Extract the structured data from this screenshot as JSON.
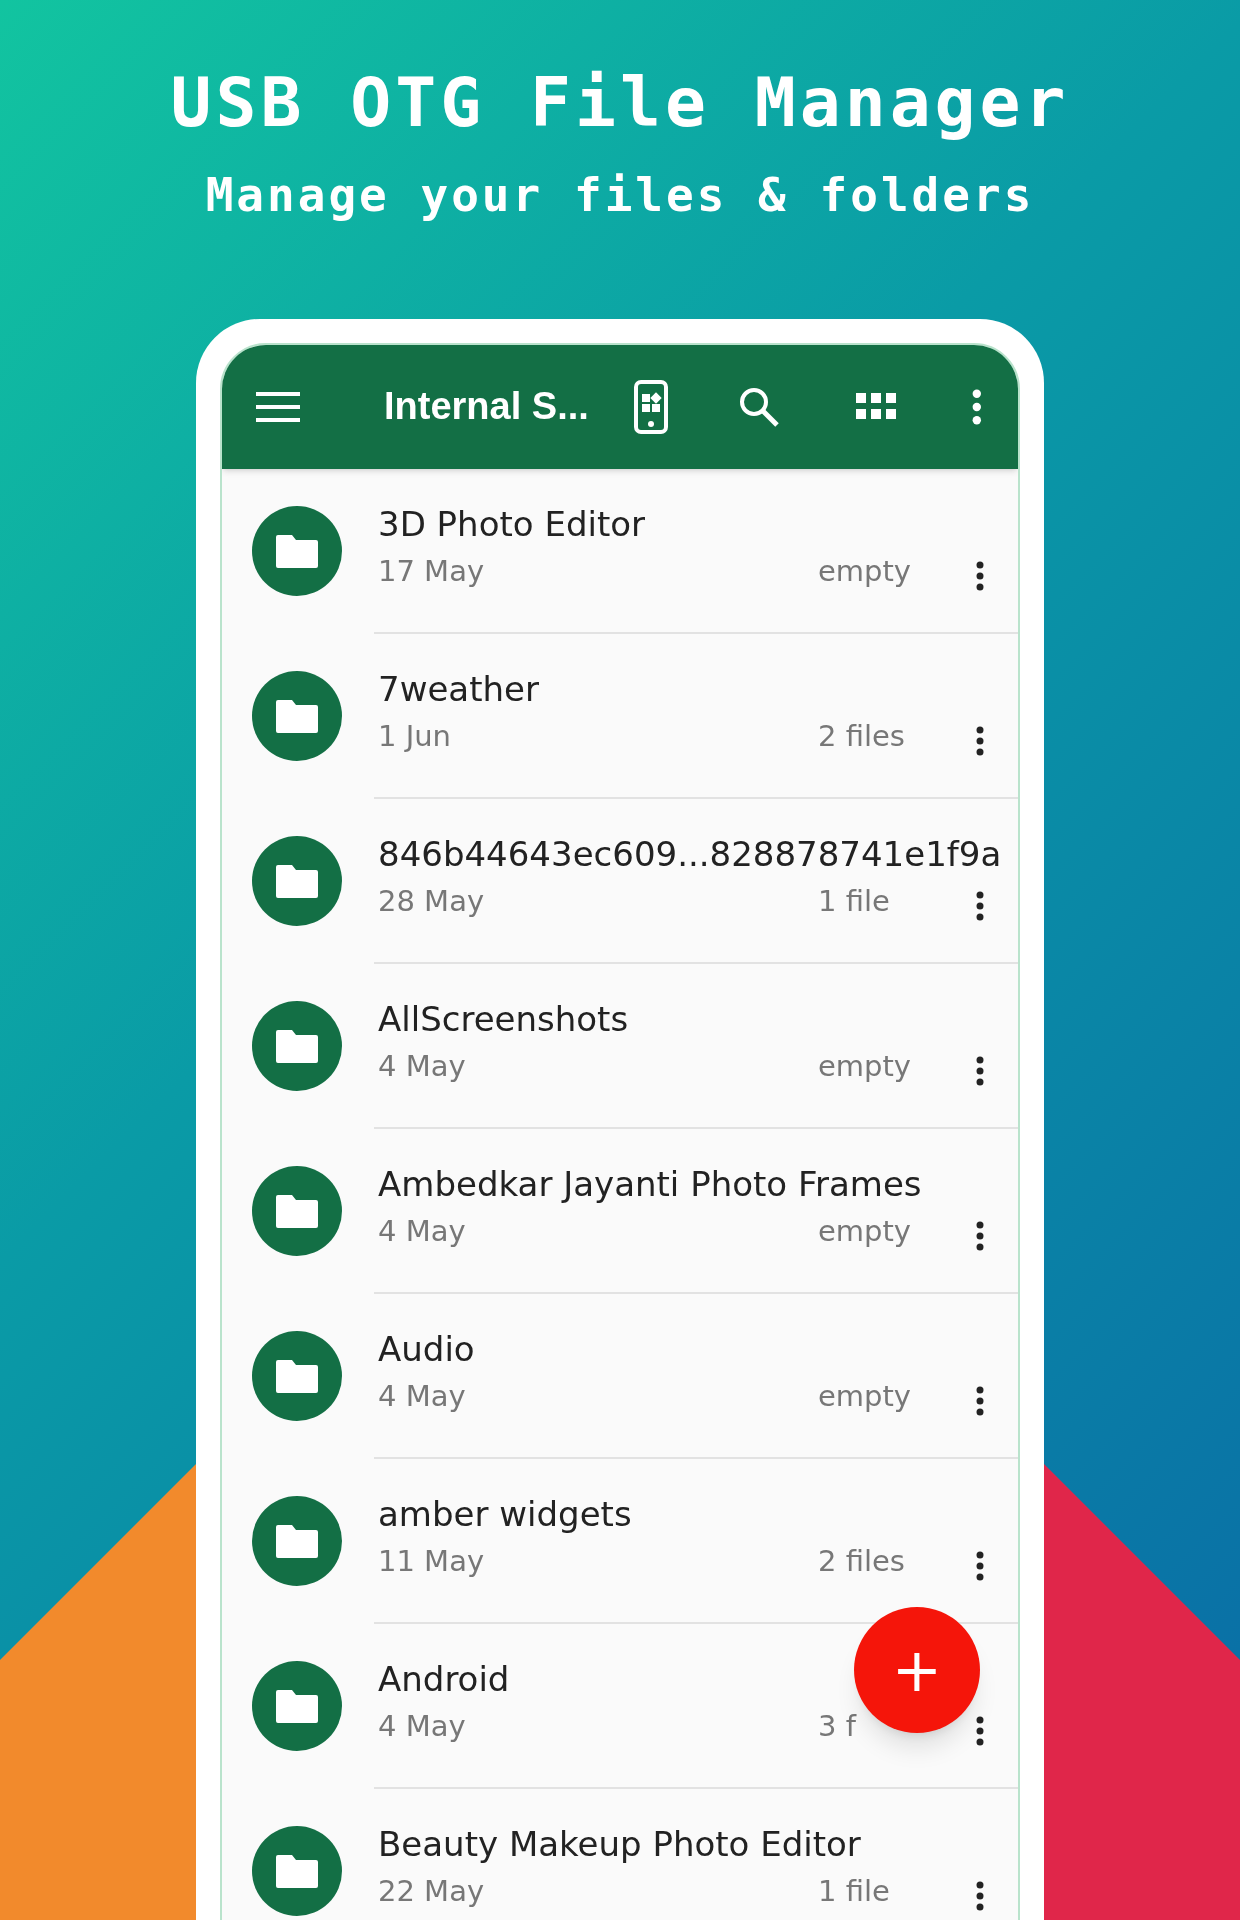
{
  "headline": "USB OTG File Manager",
  "subheadline": "Manage your files & folders",
  "toolbar": {
    "title": "Internal S..."
  },
  "folders": [
    {
      "name": "3D Photo Editor",
      "date": "17 May",
      "count": "empty"
    },
    {
      "name": "7weather",
      "date": "1 Jun",
      "count": "2 files"
    },
    {
      "name": "846b44643ec609...828878741e1f9a",
      "date": "28 May",
      "count": "1 file"
    },
    {
      "name": "AllScreenshots",
      "date": "4 May",
      "count": "empty"
    },
    {
      "name": "Ambedkar Jayanti Photo Frames",
      "date": "4 May",
      "count": "empty"
    },
    {
      "name": "Audio",
      "date": "4 May",
      "count": "empty"
    },
    {
      "name": "amber widgets",
      "date": "11 May",
      "count": "2 files"
    },
    {
      "name": "Android",
      "date": "4 May",
      "count": "3 f"
    },
    {
      "name": "Beauty Makeup Photo Editor",
      "date": "22 May",
      "count": "1 file"
    }
  ],
  "fab": {
    "label": "+"
  }
}
